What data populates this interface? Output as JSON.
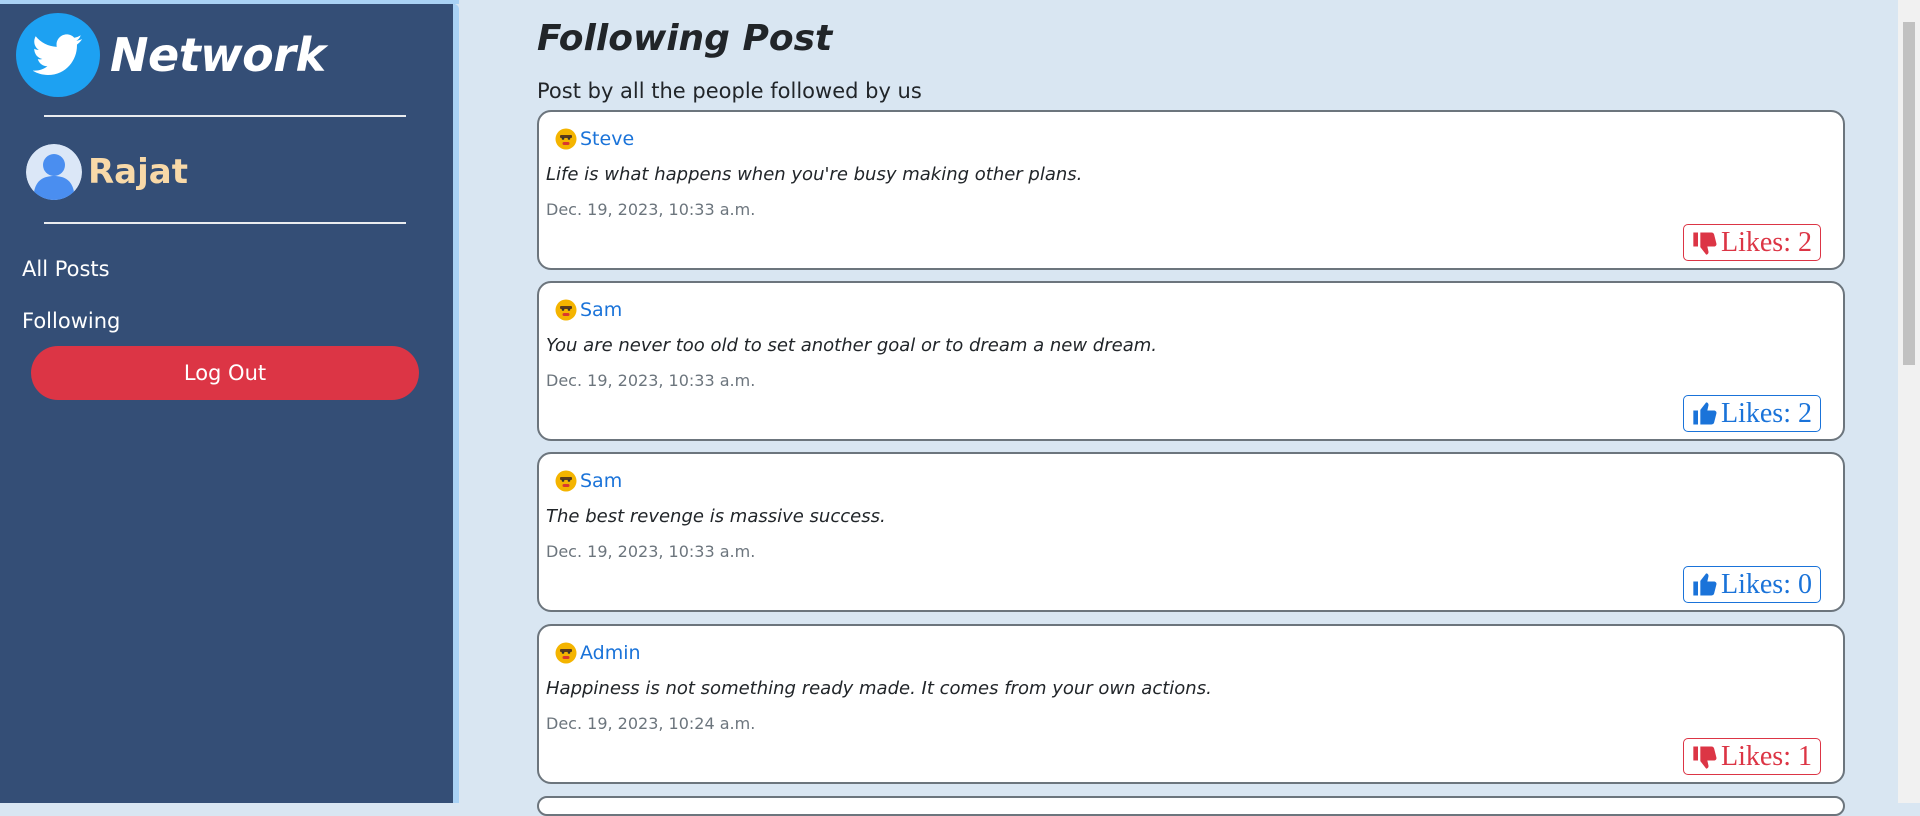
{
  "brand": {
    "name": "Network",
    "icon": "twitter-bird-icon"
  },
  "user": {
    "name": "Rajat",
    "icon": "user-avatar-icon"
  },
  "nav": {
    "all_posts": "All Posts",
    "following": "Following",
    "logout": "Log Out"
  },
  "main": {
    "title": "Following Post",
    "subtitle": "Post by all the people followed by us"
  },
  "posts": [
    {
      "author": "Steve",
      "content": "Life is what happens when you're busy making other plans.",
      "timestamp": "Dec. 19, 2023, 10:33 a.m.",
      "likes_label": "Likes: 2",
      "liked": true
    },
    {
      "author": "Sam",
      "content": "You are never too old to set another goal or to dream a new dream.",
      "timestamp": "Dec. 19, 2023, 10:33 a.m.",
      "likes_label": "Likes: 2",
      "liked": false
    },
    {
      "author": "Sam",
      "content": "The best revenge is massive success.",
      "timestamp": "Dec. 19, 2023, 10:33 a.m.",
      "likes_label": "Likes: 0",
      "liked": false
    },
    {
      "author": "Admin",
      "content": "Happiness is not something ready made. It comes from your own actions.",
      "timestamp": "Dec. 19, 2023, 10:24 a.m.",
      "likes_label": "Likes: 1",
      "liked": true
    }
  ],
  "colors": {
    "sidebar_bg": "#344e76",
    "page_bg": "#d9e6f2",
    "danger": "#dc3545",
    "link": "#1a73d9",
    "username": "#f8d9a8"
  }
}
